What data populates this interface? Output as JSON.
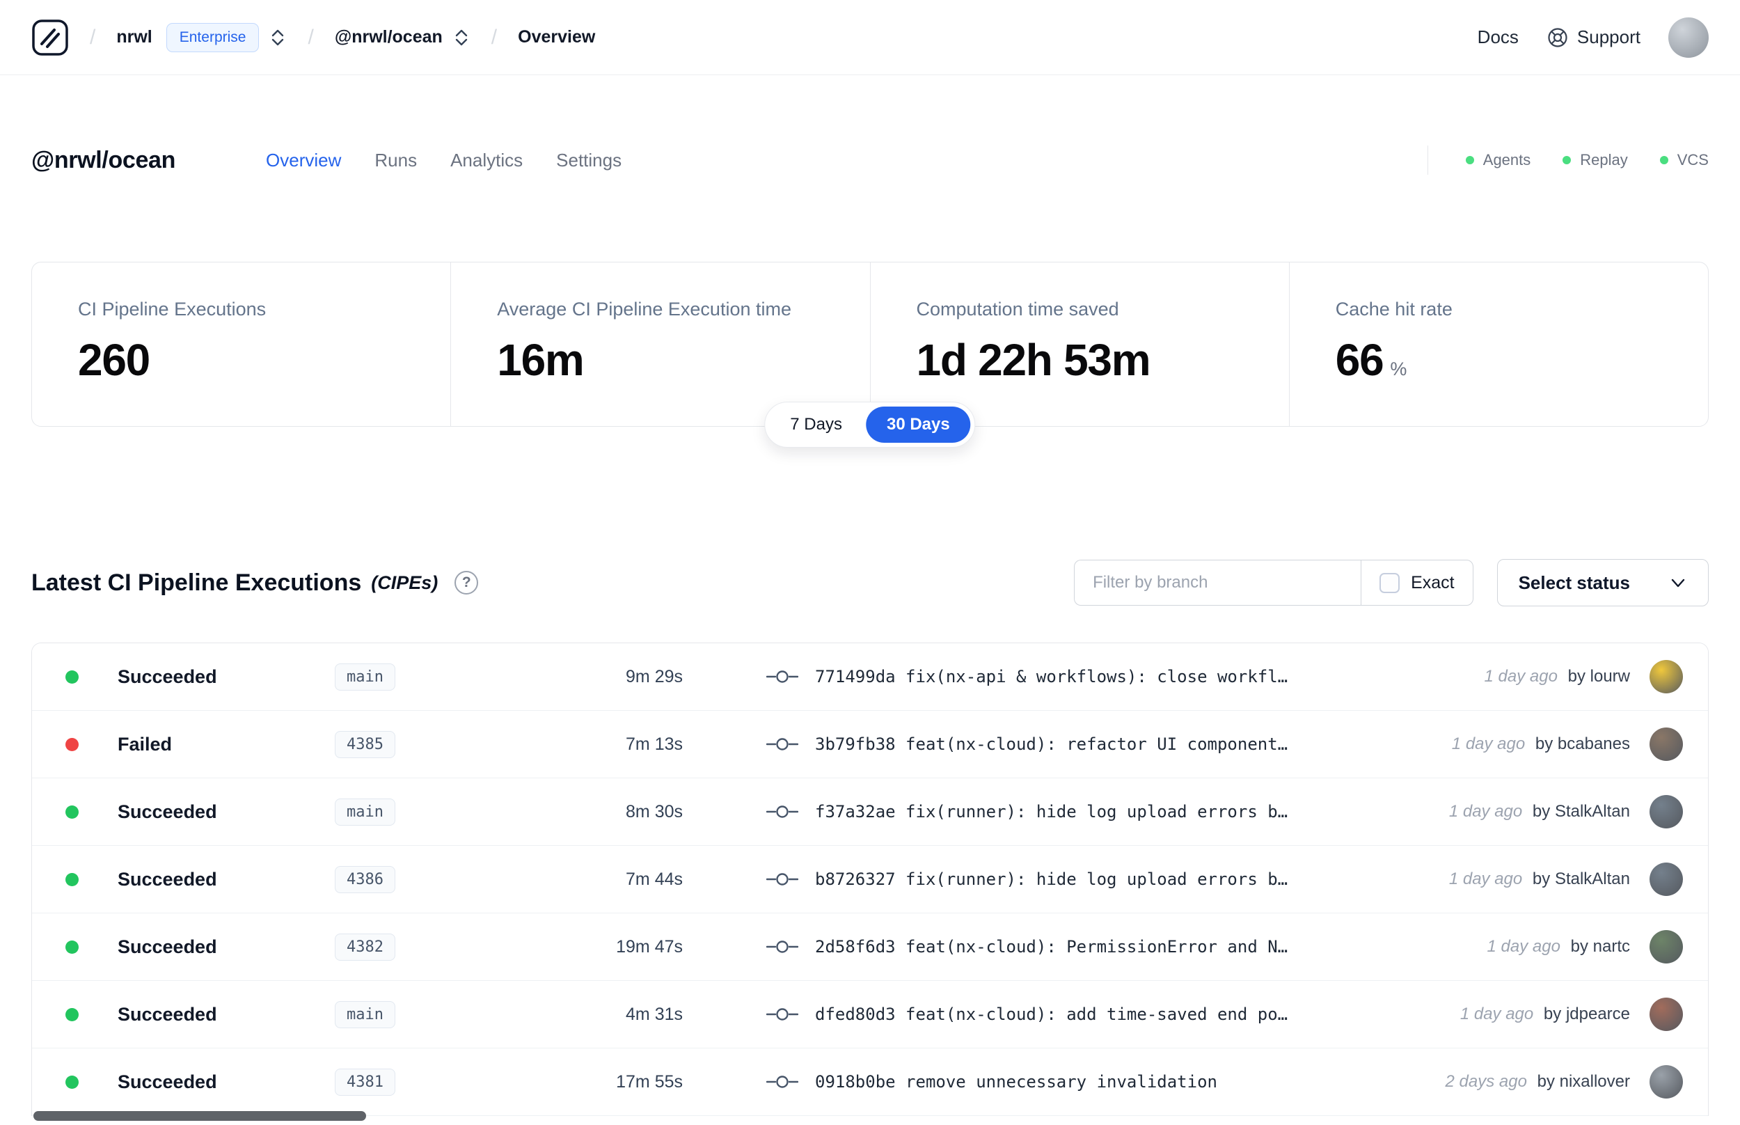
{
  "header": {
    "separator": "/",
    "org": "nrwl",
    "org_badge": "Enterprise",
    "workspace": "@nrwl/ocean",
    "page": "Overview",
    "docs_label": "Docs",
    "support_label": "Support"
  },
  "workspace": {
    "title": "@nrwl/ocean",
    "tabs": [
      {
        "label": "Overview"
      },
      {
        "label": "Runs"
      },
      {
        "label": "Analytics"
      },
      {
        "label": "Settings"
      }
    ],
    "indicators": [
      {
        "label": "Agents"
      },
      {
        "label": "Replay"
      },
      {
        "label": "VCS"
      }
    ]
  },
  "stats": [
    {
      "label": "CI Pipeline Executions",
      "value": "260",
      "suffix": ""
    },
    {
      "label": "Average CI Pipeline Execution time",
      "value": "16m",
      "suffix": ""
    },
    {
      "label": "Computation time saved",
      "value": "1d 22h 53m",
      "suffix": ""
    },
    {
      "label": "Cache hit rate",
      "value": "66",
      "suffix": "%"
    }
  ],
  "range_toggle": {
    "options": [
      "7 Days",
      "30 Days"
    ],
    "active": "30 Days"
  },
  "cipe": {
    "title": "Latest CI Pipeline Executions",
    "subtitle": "(CIPEs)",
    "help": "?",
    "filter_placeholder": "Filter by branch",
    "exact_label": "Exact",
    "status_label": "Select status",
    "rows": [
      {
        "status": "Succeeded",
        "branch": "main",
        "duration": "9m 29s",
        "commit": "771499da fix(nx-api & workflows): close workfl…",
        "when": "1 day ago",
        "author": "by lourw",
        "avatar_color": "#f0c83c"
      },
      {
        "status": "Failed",
        "branch": "4385",
        "duration": "7m 13s",
        "commit": "3b79fb38 feat(nx-cloud): refactor UI component…",
        "when": "1 day ago",
        "author": "by bcabanes",
        "avatar_color": "#8a7767"
      },
      {
        "status": "Succeeded",
        "branch": "main",
        "duration": "8m 30s",
        "commit": "f37a32ae fix(runner): hide log upload errors b…",
        "when": "1 day ago",
        "author": "by StalkAltan",
        "avatar_color": "#74808c"
      },
      {
        "status": "Succeeded",
        "branch": "4386",
        "duration": "7m 44s",
        "commit": "b8726327 fix(runner): hide log upload errors b…",
        "when": "1 day ago",
        "author": "by StalkAltan",
        "avatar_color": "#74808c"
      },
      {
        "status": "Succeeded",
        "branch": "4382",
        "duration": "19m 47s",
        "commit": "2d58f6d3 feat(nx-cloud): PermissionError and N…",
        "when": "1 day ago",
        "author": "by nartc",
        "avatar_color": "#6d8468"
      },
      {
        "status": "Succeeded",
        "branch": "main",
        "duration": "4m 31s",
        "commit": "dfed80d3 feat(nx-cloud): add time-saved end po…",
        "when": "1 day ago",
        "author": "by jdpearce",
        "avatar_color": "#a26c5c"
      },
      {
        "status": "Succeeded",
        "branch": "4381",
        "duration": "17m 55s",
        "commit": "0918b0be remove unnecessary invalidation",
        "when": "2 days ago",
        "author": "by nixallover",
        "avatar_color": "#9aa1a9"
      }
    ]
  },
  "colors": {
    "accent": "#2563eb",
    "success": "#22c55e",
    "failed": "#ef4444"
  }
}
